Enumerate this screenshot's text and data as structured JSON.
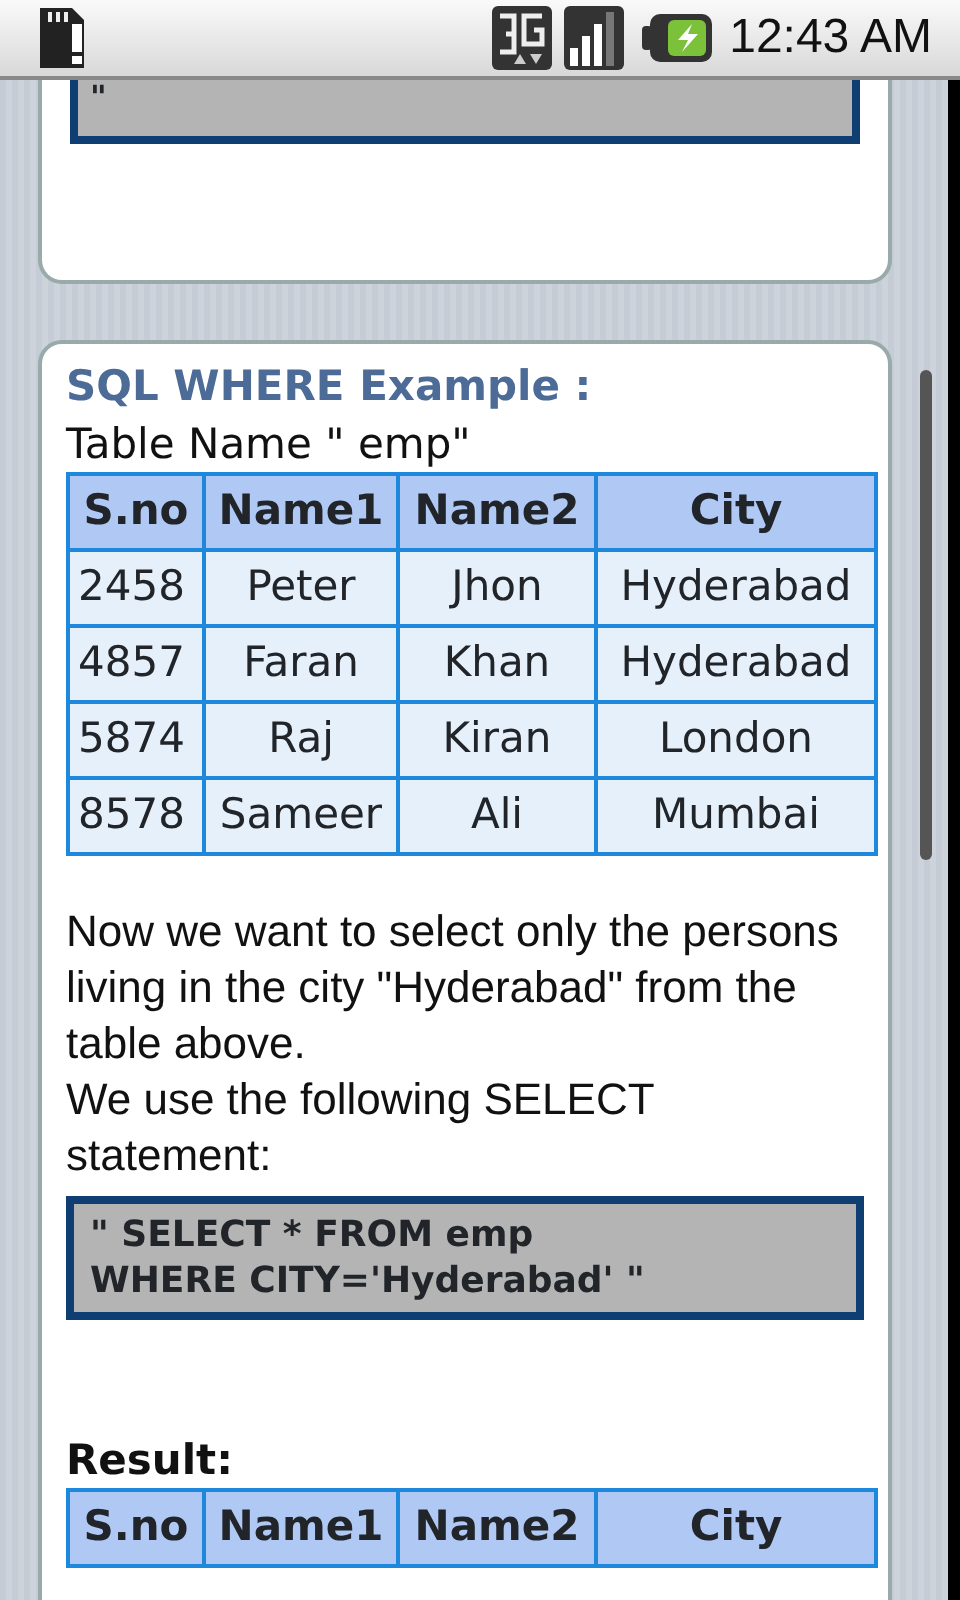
{
  "status_bar": {
    "time": "12:43 AM"
  },
  "previous_card": {
    "code": "\""
  },
  "example_card": {
    "title": "SQL WHERE Example :",
    "table_caption": "Table Name \" emp\"",
    "table": {
      "columns": [
        "S.no",
        "Name1",
        "Name2",
        "City"
      ],
      "rows": [
        [
          "2458",
          "Peter",
          "Jhon",
          "Hyderabad"
        ],
        [
          "4857",
          "Faran",
          "Khan",
          "Hyderabad"
        ],
        [
          "5874",
          "Raj",
          "Kiran",
          "London"
        ],
        [
          "8578",
          "Sameer",
          "Ali",
          "Mumbai"
        ]
      ]
    },
    "paragraphs": [
      "Now we want to select only the persons living in the city \"Hyderabad\" from the table above.",
      "We use the following SELECT statement:"
    ],
    "code_lines": [
      "\" SELECT * FROM emp",
      "WHERE CITY='Hyderabad' \""
    ],
    "result_label": "Result:",
    "result_table": {
      "columns": [
        "S.no",
        "Name1",
        "Name2",
        "City"
      ]
    }
  }
}
